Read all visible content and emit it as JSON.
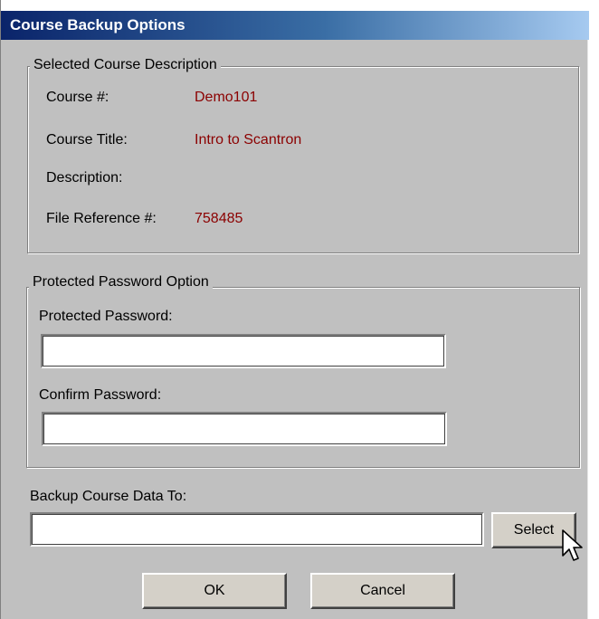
{
  "window": {
    "title": "Course Backup Options"
  },
  "course_description": {
    "legend": "Selected Course Description",
    "course_number_label": "Course #:",
    "course_number_value": "Demo101",
    "course_title_label": "Course Title:",
    "course_title_value": "Intro to Scantron",
    "description_label": "Description:",
    "description_value": "",
    "file_reference_label": "File Reference #:",
    "file_reference_value": "758485"
  },
  "password_option": {
    "legend": "Protected Password Option",
    "password_label": "Protected Password:",
    "password_value": "",
    "confirm_label": "Confirm Password:",
    "confirm_value": ""
  },
  "backup": {
    "label": "Backup Course Data To:",
    "path_value": "",
    "select_label": "Select"
  },
  "buttons": {
    "ok_label": "OK",
    "cancel_label": "Cancel"
  },
  "colors": {
    "value_text": "#8b0000",
    "dialog_bg": "#c0c0c0",
    "title_bar": "#0a246a"
  },
  "icons": {
    "cursor": "arrow-pointer-icon"
  }
}
